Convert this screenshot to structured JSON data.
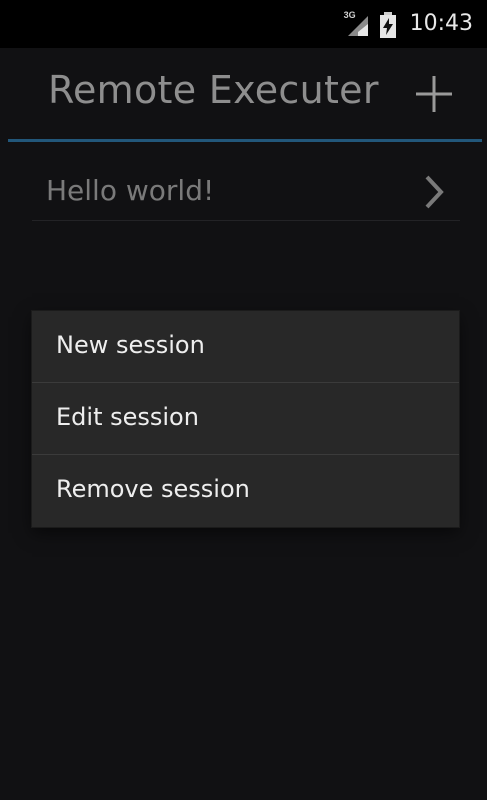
{
  "status_bar": {
    "network_label": "3G",
    "time": "10:43",
    "icons": [
      "signal-3g-icon",
      "battery-charging-icon"
    ]
  },
  "action_bar": {
    "title": "Remote Executer",
    "add_icon": "plus-icon"
  },
  "sessions": [
    {
      "label": "Hello world!",
      "icon": "chevron-right-icon"
    }
  ],
  "context_menu": {
    "items": [
      {
        "label": "New session"
      },
      {
        "label": "Edit session"
      },
      {
        "label": "Remove session"
      }
    ]
  },
  "colors": {
    "background": "#111113",
    "accent": "#22577a",
    "menu_background": "#282828"
  }
}
